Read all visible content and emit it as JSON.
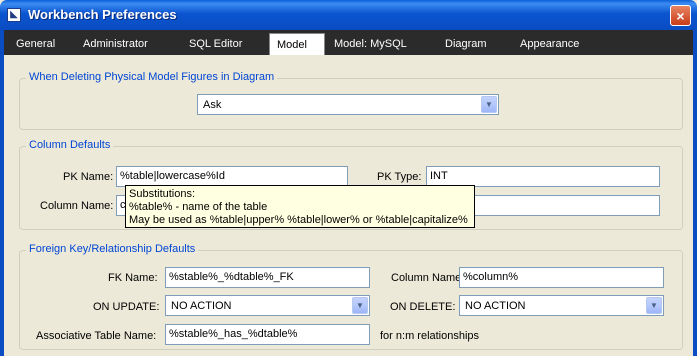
{
  "window": {
    "title": "Workbench Preferences",
    "close_glyph": "×",
    "app_icon_glyph": "◣"
  },
  "tabs": [
    {
      "label": "General",
      "active": false
    },
    {
      "label": "Administrator",
      "active": false
    },
    {
      "label": "SQL Editor",
      "active": false
    },
    {
      "label": "Model",
      "active": true
    },
    {
      "label": "Model: MySQL",
      "active": false
    },
    {
      "label": "Diagram",
      "active": false
    },
    {
      "label": "Appearance",
      "active": false
    }
  ],
  "delete_group": {
    "legend": "When Deleting Physical Model Figures in Diagram",
    "selected": "Ask"
  },
  "column_defaults": {
    "legend": "Column Defaults",
    "pk_name_label": "PK Name:",
    "pk_name_value": "%table|lowercase%Id",
    "pk_type_label": "PK Type:",
    "pk_type_value": "INT",
    "column_name_label": "Column Name:",
    "column_name_value_visible": "c",
    "column_type_value_visible": "R(64)"
  },
  "tooltip": {
    "line1": "Substitutions:",
    "line2": "%table% - name of the table",
    "line3": "May be used as %table|upper% %table|lower% or %table|capitalize%"
  },
  "fk_defaults": {
    "legend": "Foreign Key/Relationship Defaults",
    "fk_name_label": "FK Name:",
    "fk_name_value": "%stable%_%dtable%_FK",
    "column_name_label": "Column Name:",
    "column_name_value": "%column%",
    "on_update_label": "ON UPDATE:",
    "on_update_value": "NO ACTION",
    "on_delete_label": "ON DELETE:",
    "on_delete_value": "NO ACTION",
    "assoc_label": "Associative Table Name:",
    "assoc_value": "%stable%_has_%dtable%",
    "assoc_hint": "for n:m relationships"
  },
  "dropdown_glyph": "▼"
}
